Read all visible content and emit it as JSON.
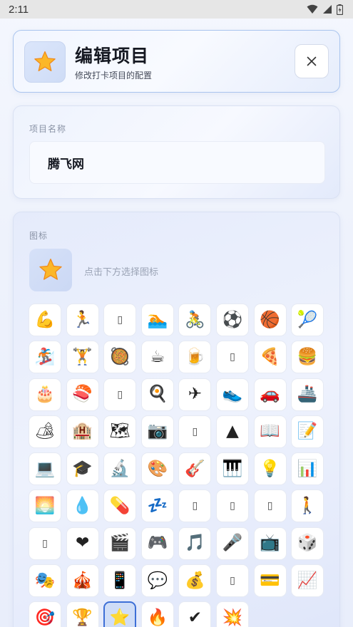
{
  "status_bar": {
    "time": "2:11"
  },
  "header": {
    "title": "编辑项目",
    "subtitle": "修改打卡项目的配置",
    "icon": "star-icon",
    "close_icon": "close-icon"
  },
  "name_section": {
    "label": "项目名称",
    "value": "腾飞网"
  },
  "icon_section": {
    "label": "图标",
    "selected_icon": "⭐",
    "hint": "点击下方选择图标",
    "icons": [
      "💪",
      "🏃",
      "▯",
      "🏊",
      "🚴",
      "⚽",
      "🏀",
      "🎾",
      "🏂",
      "🏋",
      "🥘",
      "☕",
      "🍺",
      "▯",
      "🍕",
      "🍔",
      "🎂",
      "🍣",
      "▯",
      "🍳",
      "✈",
      "👟",
      "🚗",
      "🚢",
      "🏕",
      "🏨",
      "🗺",
      "📷",
      "▯",
      "▲",
      "📖",
      "📝",
      "💻",
      "🎓",
      "🔬",
      "🎨",
      "🎸",
      "🎹",
      "💡",
      "📊",
      "🌅",
      "💧",
      "💊",
      "💤",
      "▯",
      "▯",
      "▯",
      "🚶",
      "▯",
      "❤",
      "🎬",
      "🎮",
      "🎵",
      "🎤",
      "📺",
      "🎲",
      "🎭",
      "🎪",
      "📱",
      "💬",
      "💰",
      "▯",
      "💳",
      "📈",
      "🎯",
      "🏆",
      "⭐",
      "🔥",
      "✔",
      "💥"
    ],
    "selected_index": 66
  },
  "colors": {
    "accent": "#3d6fd6",
    "title": "#161922",
    "label": "#8a93a6"
  }
}
